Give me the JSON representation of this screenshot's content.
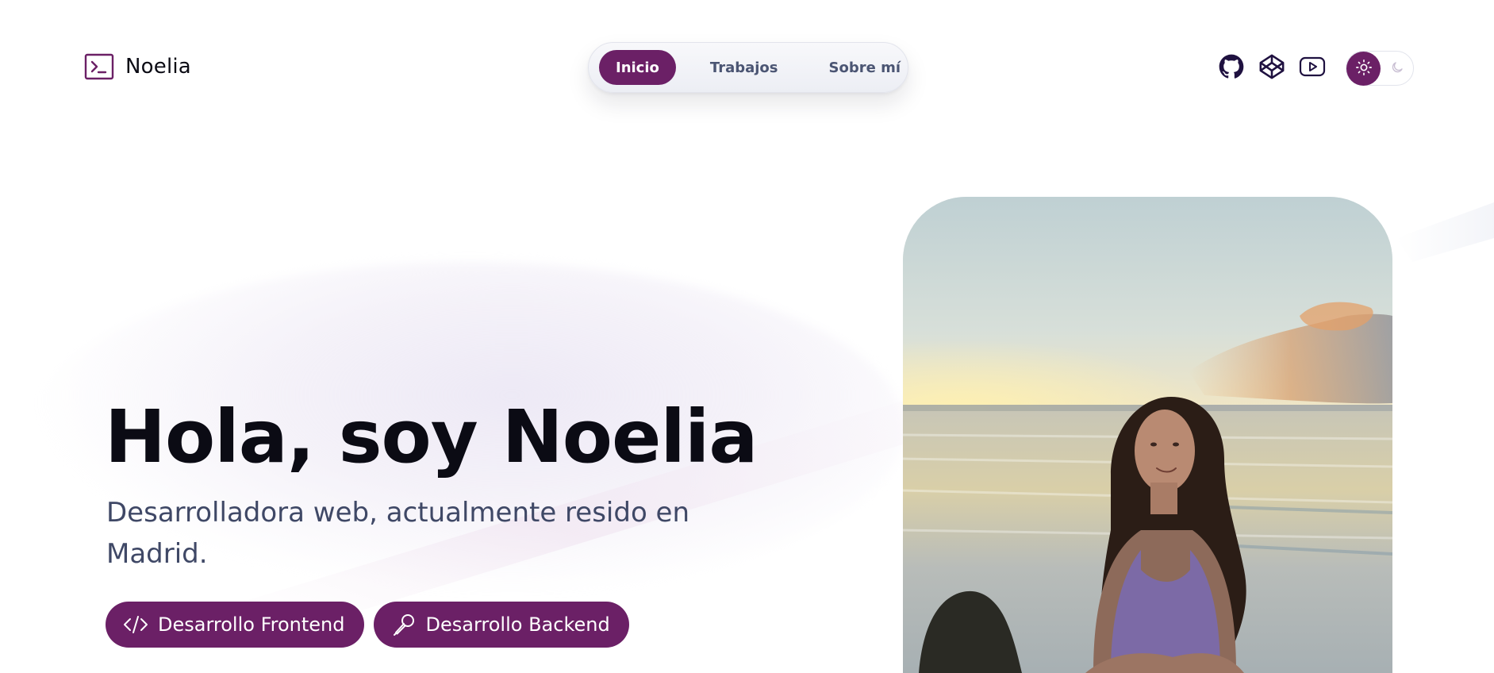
{
  "site": {
    "logo": {
      "icon": "terminal-icon",
      "name": "Noelia"
    }
  },
  "nav": {
    "items": [
      {
        "label": "Inicio",
        "active": true
      },
      {
        "label": "Trabajos",
        "active": false
      },
      {
        "label": "Sobre mí",
        "active": false
      }
    ]
  },
  "social": {
    "icons": [
      "github-icon",
      "codepen-icon",
      "youtube-icon"
    ]
  },
  "theme_toggle": {
    "selected": "light",
    "icons": [
      "sun-icon",
      "moon-icon"
    ]
  },
  "hero": {
    "title": "Hola, soy Noelia",
    "subtitle": "Desarrolladora web, actualmente resido en Madrid.",
    "buttons": [
      {
        "label": "Desarrollo Frontend",
        "icon": "code-icon"
      },
      {
        "label": "Desarrollo Backend",
        "icon": "microphone-icon"
      }
    ]
  },
  "photo": {
    "description_icon": "profile-photo"
  },
  "colors": {
    "accent": "#6b2066",
    "text_dark": "#0b0b14",
    "text_muted": "#3f4866",
    "nav_text": "#4b5573",
    "icon_dark": "#1f1140"
  }
}
